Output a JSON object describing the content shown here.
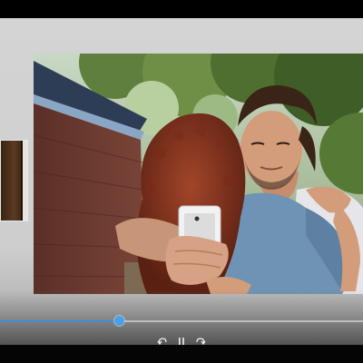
{
  "viewer": {
    "mode": "slideshow",
    "current_photo_description": "",
    "progress_fraction": 0.328,
    "accent_color": "#3f8fd6"
  },
  "controls": {
    "previous_icon": "rotate-left-icon",
    "pause_icon": "pause-icon",
    "next_icon": "rotate-right-icon"
  },
  "colors": {
    "stage_background": "#d2d2d2",
    "frame_background": "#000000",
    "progress_fill": "#3f8fd6",
    "progress_thumb": "#4aa0ea"
  }
}
